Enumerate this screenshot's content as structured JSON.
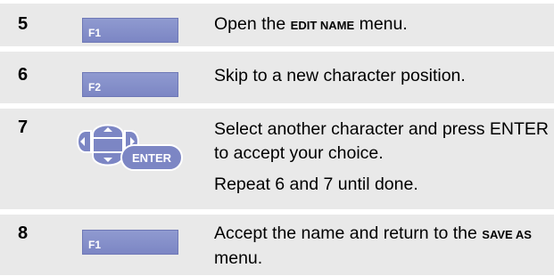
{
  "steps": [
    {
      "number": "5",
      "key_label": "F1",
      "text_before": "Open the ",
      "text_bold": "EDIT NAME",
      "text_after": " menu."
    },
    {
      "number": "6",
      "key_label": "F2",
      "text": "Skip to a new character position."
    },
    {
      "number": "7",
      "enter_label": "ENTER",
      "text": "Select another character and press ENTER to accept your choice.",
      "note": "Repeat 6 and 7 until done."
    },
    {
      "number": "8",
      "key_label": "F1",
      "text_before": "Accept the name and return to the ",
      "text_bold": "SAVE AS",
      "text_after": " menu."
    }
  ],
  "colors": {
    "row_background": "#e9e9e9",
    "key_fill": "#8590ca",
    "nav_fill": "#7c86c4"
  }
}
